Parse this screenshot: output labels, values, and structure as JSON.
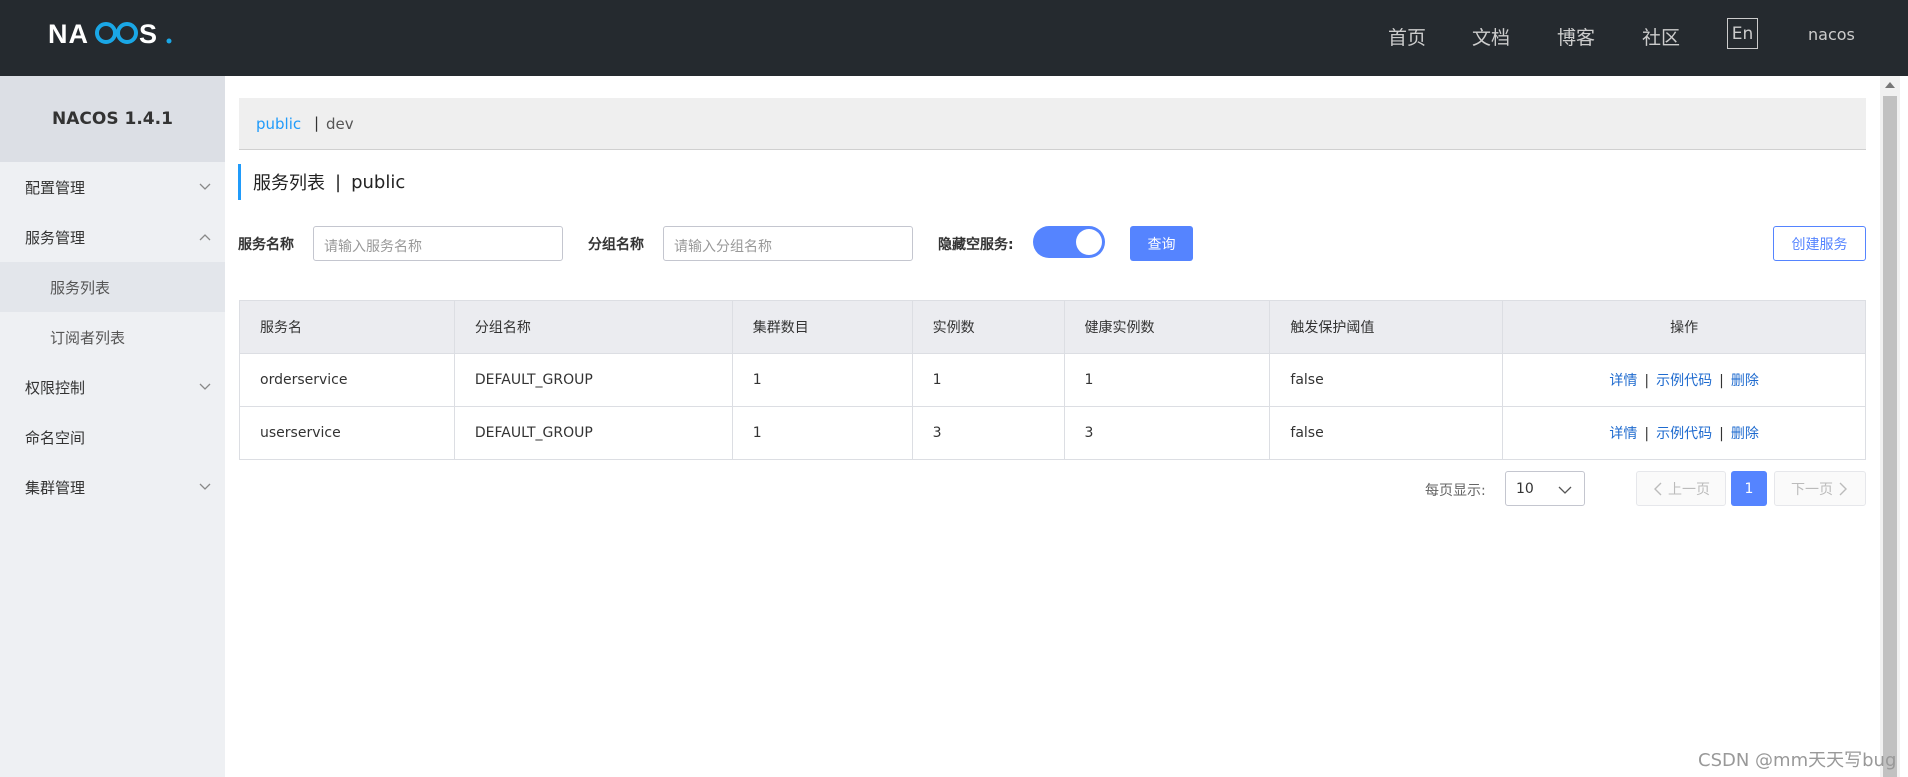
{
  "header": {
    "logo_text": "NACOS.",
    "nav": [
      "首页",
      "文档",
      "博客",
      "社区"
    ],
    "lang": "En",
    "user": "nacos"
  },
  "sidebar": {
    "title": "NACOS 1.4.1",
    "items": [
      {
        "label": "配置管理",
        "icon": "chevron-down-icon"
      },
      {
        "label": "服务管理",
        "icon": "chevron-up-icon"
      },
      {
        "label": "服务列表"
      },
      {
        "label": "订阅者列表"
      },
      {
        "label": "权限控制",
        "icon": "chevron-down-icon"
      },
      {
        "label": "命名空间"
      },
      {
        "label": "集群管理",
        "icon": "chevron-down-icon"
      }
    ]
  },
  "namespace": {
    "active": "public",
    "sep": "|",
    "other": "dev"
  },
  "page": {
    "title": "服务列表",
    "sep": "|",
    "namespace": "public"
  },
  "filters": {
    "service_name_label": "服务名称",
    "service_name_placeholder": "请输入服务名称",
    "group_name_label": "分组名称",
    "group_name_placeholder": "请输入分组名称",
    "hide_empty_label": "隐藏空服务:",
    "hide_empty_on": true,
    "query_label": "查询",
    "create_label": "创建服务"
  },
  "table": {
    "headers": [
      "服务名",
      "分组名称",
      "集群数目",
      "实例数",
      "健康实例数",
      "触发保护阈值",
      "操作"
    ],
    "rows": [
      [
        "orderservice",
        "DEFAULT_GROUP",
        "1",
        "1",
        "1",
        "false"
      ],
      [
        "userservice",
        "DEFAULT_GROUP",
        "1",
        "3",
        "3",
        "false"
      ]
    ],
    "ops": [
      "详情",
      "示例代码",
      "删除"
    ],
    "op_sep": "|"
  },
  "pagination": {
    "page_size_label": "每页显示:",
    "page_size": "10",
    "prev": "上一页",
    "current": "1",
    "next": "下一页"
  },
  "watermark": "CSDN @mm天天写bug",
  "colors": {
    "header_bg": "#252a2f",
    "accent": "#5584ff",
    "link": "#209bfa",
    "sidebar_bg": "#eef0f3"
  }
}
